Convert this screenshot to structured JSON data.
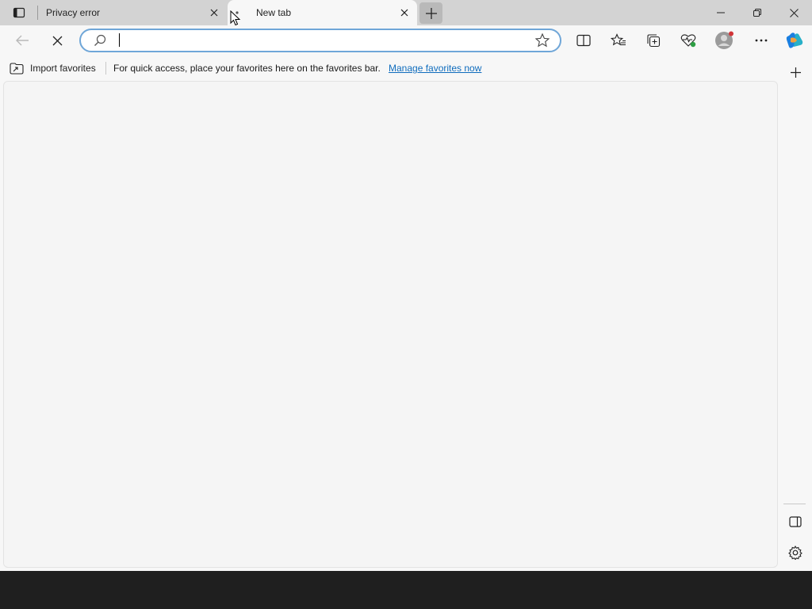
{
  "tabs": [
    {
      "title": "Privacy error",
      "active": false
    },
    {
      "title": "New tab",
      "active": true
    }
  ],
  "address_bar": {
    "value": "",
    "placeholder": ""
  },
  "favorites_bar": {
    "import_label": "Import favorites",
    "message": "For quick access, place your favorites here on the favorites bar.",
    "link_label": "Manage favorites now"
  },
  "icons": {
    "tab_actions": "tab-actions-icon",
    "new_tab": "plus-icon",
    "back": "back-arrow-icon",
    "stop": "close-icon",
    "search": "search-icon",
    "favorite": "star-icon",
    "split_screen": "split-screen-icon",
    "favorites": "favorites-icon",
    "collections": "collections-icon",
    "browser_essentials": "heart-pulse-icon",
    "profile": "avatar-icon",
    "more": "ellipsis-icon",
    "copilot": "copilot-icon",
    "sidebar_add": "plus-icon",
    "sidebar_toggle": "sidebar-icon",
    "settings": "gear-icon"
  },
  "colors": {
    "accent": "#0f6cbd",
    "address_focus": "#6fa6d8",
    "profile_badge": "#d13438",
    "essentials_badge": "#2e9e44",
    "tab_strip": "#d3d3d3",
    "taskbar": "#1f1f1f"
  }
}
